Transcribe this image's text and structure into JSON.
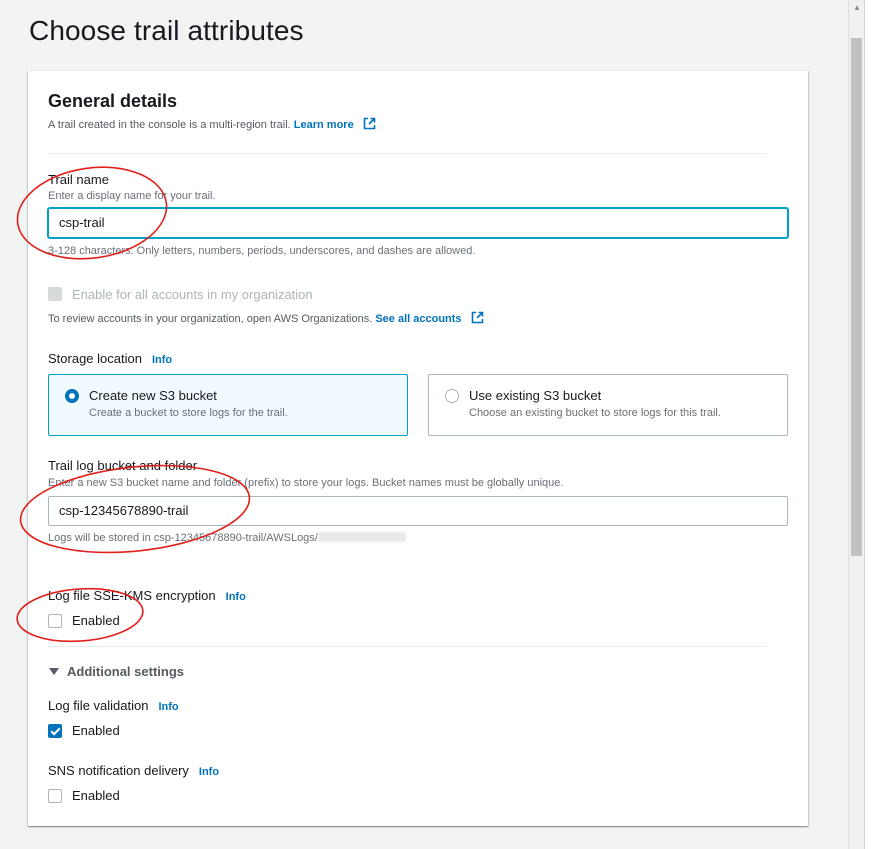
{
  "page": {
    "title": "Choose trail attributes"
  },
  "general": {
    "title": "General details",
    "description": "A trail created in the console is a multi-region trail.",
    "learn_more": "Learn more"
  },
  "trail_name": {
    "label": "Trail name",
    "description": "Enter a display name for your trail.",
    "value": "csp-trail",
    "constraint": "3-128 characters. Only letters, numbers, periods, underscores, and dashes are allowed."
  },
  "org": {
    "checkbox_label": "Enable for all accounts in my organization",
    "review_text": "To review accounts in your organization, open AWS Organizations.",
    "see_all": "See all accounts"
  },
  "storage": {
    "label": "Storage location",
    "info": "Info",
    "options": [
      {
        "title": "Create new S3 bucket",
        "description": "Create a bucket to store logs for the trail.",
        "selected": true
      },
      {
        "title": "Use existing S3 bucket",
        "description": "Choose an existing bucket to store logs for this trail.",
        "selected": false
      }
    ]
  },
  "bucket": {
    "label": "Trail log bucket and folder",
    "description": "Enter a new S3 bucket name and folder (prefix) to store your logs. Bucket names must be globally unique.",
    "value": "csp-12345678890-trail",
    "stored_prefix": "Logs will be stored in csp-12345678890-trail/AWSLogs/"
  },
  "kms": {
    "label": "Log file SSE-KMS encryption",
    "info": "Info",
    "enabled_label": "Enabled",
    "checked": false
  },
  "additional": {
    "label": "Additional settings"
  },
  "validation": {
    "label": "Log file validation",
    "info": "Info",
    "enabled_label": "Enabled",
    "checked": true
  },
  "sns": {
    "label": "SNS notification delivery",
    "info": "Info",
    "enabled_label": "Enabled",
    "checked": false
  },
  "colors": {
    "link": "#0073bb",
    "focus": "#00a1c9",
    "annotation": "#e0201b"
  }
}
